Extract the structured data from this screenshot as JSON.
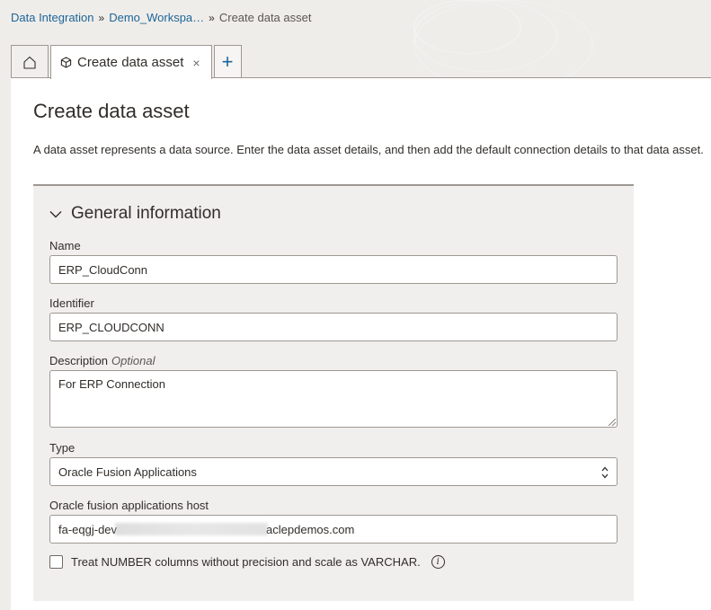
{
  "breadcrumb": {
    "items": [
      "Data Integration",
      "Demo_Workspa…"
    ],
    "current": "Create data asset",
    "separator": "»"
  },
  "tabs": {
    "active_label": "Create data asset",
    "close_glyph": "×",
    "add_glyph": "+"
  },
  "page": {
    "title": "Create data asset",
    "description": "A data asset represents a data source. Enter the data asset details, and then add the default connection details to that data asset."
  },
  "section": {
    "title": "General information"
  },
  "form": {
    "name_label": "Name",
    "name_value": "ERP_CloudConn",
    "identifier_label": "Identifier",
    "identifier_value": "ERP_CLOUDCONN",
    "description_label": "Description",
    "description_optional": "Optional",
    "description_value": "For ERP Connection",
    "type_label": "Type",
    "type_value": "Oracle Fusion Applications",
    "host_label": "Oracle fusion applications host",
    "host_value_start": "fa-eqgj-dev",
    "host_value_end": "aclepdemos.com",
    "checkbox_label": "Treat NUMBER columns without precision and scale as VARCHAR.",
    "info_glyph": "i"
  },
  "icons": {
    "home": "home-icon",
    "tab": "cube-icon",
    "close": "close-icon",
    "add": "plus-icon",
    "chevron": "chevron-down-icon",
    "select": "select-arrows-icon",
    "info": "info-icon"
  },
  "colors": {
    "link": "#1e6598",
    "text": "#312d2a",
    "section_bg": "#f1efed",
    "page_bg": "#efedea"
  }
}
